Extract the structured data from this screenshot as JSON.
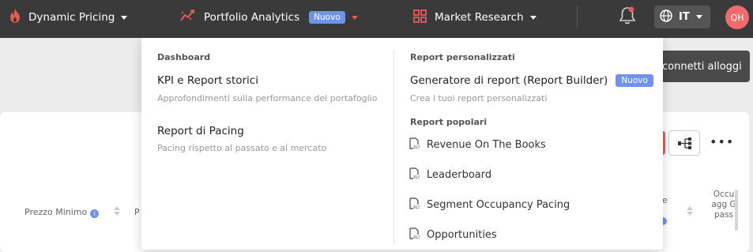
{
  "nav": {
    "dynamic_pricing": "Dynamic Pricing",
    "portfolio_analytics": "Portfolio Analytics",
    "portfolio_badge": "Nuovo",
    "market_research": "Market Research",
    "language": "IT",
    "avatar_initials": "QH",
    "accent_color": "#e85a5a"
  },
  "background": {
    "connect_button": "connetti alloggi",
    "col_min_price": "Prezzo Minimo",
    "col_partial": "P",
    "col_e": "e",
    "col_occupancy": "Occu agg G pass"
  },
  "dropdown": {
    "left": {
      "section": "Dashboard",
      "items": [
        {
          "title": "KPI e Report storici",
          "desc": "Approfondimenti sulla performance del portafoglio"
        },
        {
          "title": "Report di Pacing",
          "desc": "Pacing rispetto al passato e al mercato"
        }
      ]
    },
    "right": {
      "custom_section": "Report personalizzati",
      "builder_title": "Generatore di report (Report Builder)",
      "builder_badge": "Nuovo",
      "builder_desc": "Crea i tuoi report personalizzati",
      "popular_section": "Report popolari",
      "reports": [
        "Revenue On The Books",
        "Leaderboard",
        "Segment Occupancy Pacing",
        "Opportunities"
      ]
    }
  }
}
